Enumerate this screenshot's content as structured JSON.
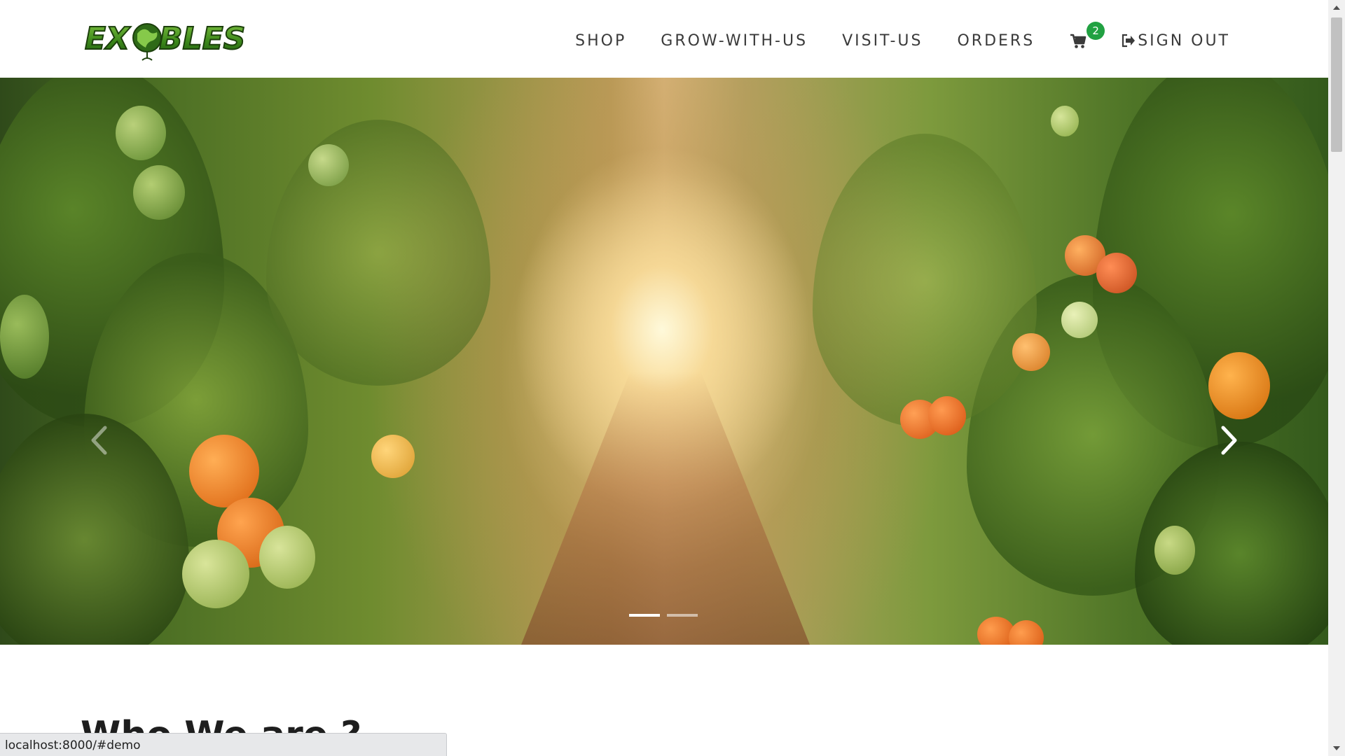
{
  "brand": {
    "logo_text": "EXOBLES",
    "primary_color": "#3f7d1e",
    "accent_color": "#21a142"
  },
  "nav": {
    "items": [
      {
        "label": "SHOP"
      },
      {
        "label": "GROW-WITH-US"
      },
      {
        "label": "VISIT-US"
      },
      {
        "label": "ORDERS"
      }
    ],
    "cart_icon": "shopping-cart-icon",
    "cart_count": "2",
    "signout_icon": "sign-out-icon",
    "signout_label": "SIGN OUT"
  },
  "hero": {
    "image": "tomato greenhouse rows with sunlight",
    "prev_icon": "chevron-left-icon",
    "next_icon": "chevron-right-icon",
    "slides_total": 2,
    "active_slide": 1
  },
  "section": {
    "title": "Who We are ?"
  },
  "status_bar": {
    "url": "localhost:8000/#demo"
  }
}
